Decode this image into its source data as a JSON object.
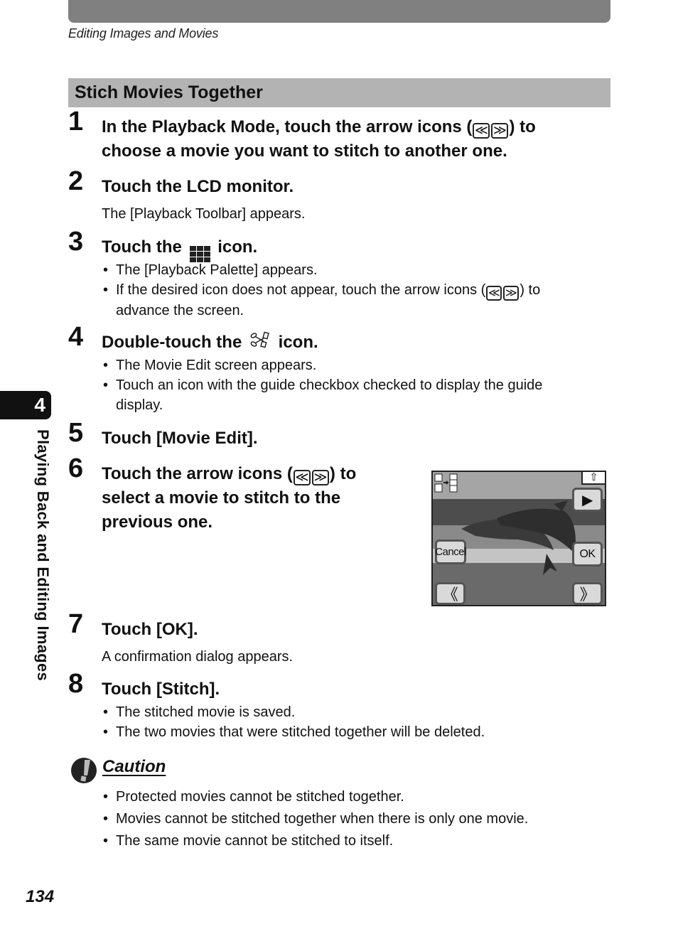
{
  "header": {
    "running_head": "Editing Images and Movies"
  },
  "section": {
    "title": "Stich Movies Together"
  },
  "steps": [
    {
      "number": "1",
      "title_parts": [
        "In the Playback Mode, touch the arrow icons (",
        ") to",
        "choose a movie you want to stitch to another one."
      ]
    },
    {
      "number": "2",
      "title": "Touch the LCD monitor.",
      "body": "The [Playback Toolbar] appears."
    },
    {
      "number": "3",
      "title_before": "Touch the",
      "title_after": "icon.",
      "icon": "mode-palette-icon",
      "bullets": [
        "The [Playback Palette] appears.",
        "If the desired icon does not appear, touch the arrow icons (",
        ") to",
        "advance the screen."
      ]
    },
    {
      "number": "4",
      "title_before": "Double-touch the",
      "title_after": "icon.",
      "icon": "movie-edit-scissors-icon",
      "bullets": [
        "The Movie Edit screen appears.",
        "Touch an icon with the guide checkbox checked to display the guide",
        "display."
      ]
    },
    {
      "number": "5",
      "title": "Touch [Movie Edit]."
    },
    {
      "number": "6",
      "title_parts": [
        "Touch the arrow icons (",
        ") to",
        "select a movie to stitch to the",
        "previous one."
      ]
    },
    {
      "number": "7",
      "title": "Touch [OK].",
      "body": "A confirmation dialog appears."
    },
    {
      "number": "8",
      "title": "Touch [Stitch].",
      "bullets": [
        "The stitched movie is saved.",
        "The two movies that were stitched together will be deleted."
      ]
    }
  ],
  "arrow_icons": {
    "left": "≪",
    "right": "≫"
  },
  "lcd_screen": {
    "back_icon": "⇧",
    "play_icon": "▶",
    "cancel_label": "Cancel",
    "ok_label": "OK",
    "prev_icon": "《",
    "next_icon": "》",
    "mode_icon": "stitch-movies-icon"
  },
  "caution": {
    "title": "Caution",
    "bullets": [
      "Protected movies cannot be stitched together.",
      "Movies cannot be stitched together when there is only one movie.",
      "The same movie cannot be stitched to itself."
    ]
  },
  "side_tab": {
    "chapter_number": "4",
    "chapter_title": "Playing Back and Editing Images"
  },
  "footer": {
    "page_number": "134"
  }
}
